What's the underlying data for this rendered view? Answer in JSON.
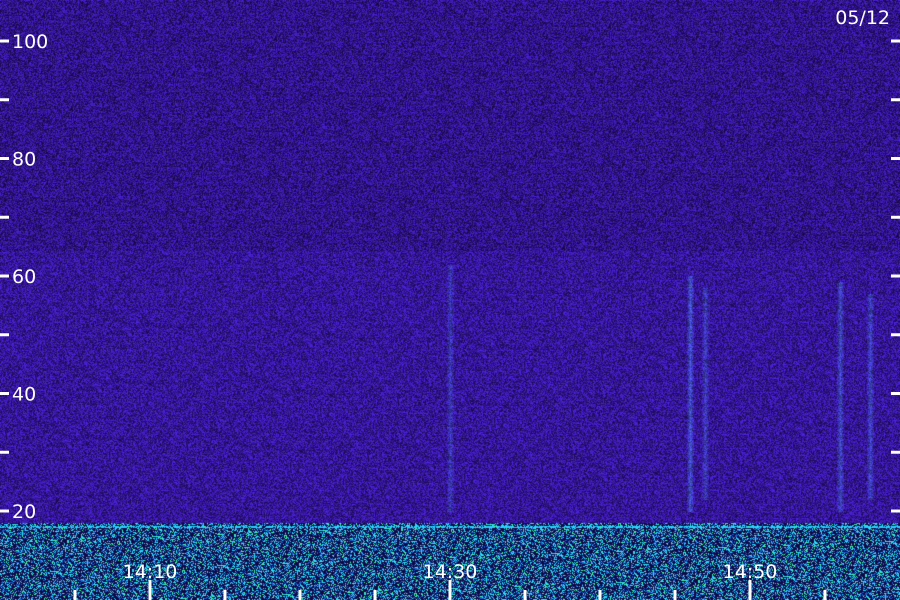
{
  "date": "05/12",
  "chart_data": {
    "type": "heatmap",
    "title": "",
    "xlabel": "",
    "ylabel": "",
    "ylim": [
      15,
      105
    ],
    "y_tick_labels": [
      "20",
      "40",
      "60",
      "80",
      "100"
    ],
    "y_ticks": [
      20,
      40,
      60,
      80,
      100
    ],
    "y_minor_ticks": [
      30,
      50,
      70,
      90
    ],
    "x_tick_labels": [
      "14:10",
      "14:30",
      "14:50"
    ],
    "x_ticks": [
      "14:10",
      "14:30",
      "14:50"
    ],
    "x_minor_ticks": [
      "14:05",
      "14:15",
      "14:20",
      "14:25",
      "14:35",
      "14:40",
      "14:45",
      "14:55"
    ],
    "xlim": [
      "14:02",
      "14:62"
    ],
    "colors": {
      "background": "#2a0a6e",
      "noise_low": "#14063c",
      "noise_high": "#4a2ae0",
      "signal": "#3a6cff",
      "band_cyan": "#27d6ff",
      "band_green": "#4dff8a"
    },
    "vertical_signals": [
      {
        "time": "14:30",
        "y_top": 62,
        "y_bottom": 20,
        "strength": 0.55
      },
      {
        "time": "14:46",
        "y_top": 60,
        "y_bottom": 20,
        "strength": 0.9
      },
      {
        "time": "14:47",
        "y_top": 58,
        "y_bottom": 22,
        "strength": 0.6
      },
      {
        "time": "14:56",
        "y_top": 59,
        "y_bottom": 20,
        "strength": 0.75
      },
      {
        "time": "14:58",
        "y_top": 57,
        "y_bottom": 22,
        "strength": 0.7
      }
    ],
    "low_frequency_band": {
      "y_top": 18,
      "y_bottom": 15
    }
  }
}
